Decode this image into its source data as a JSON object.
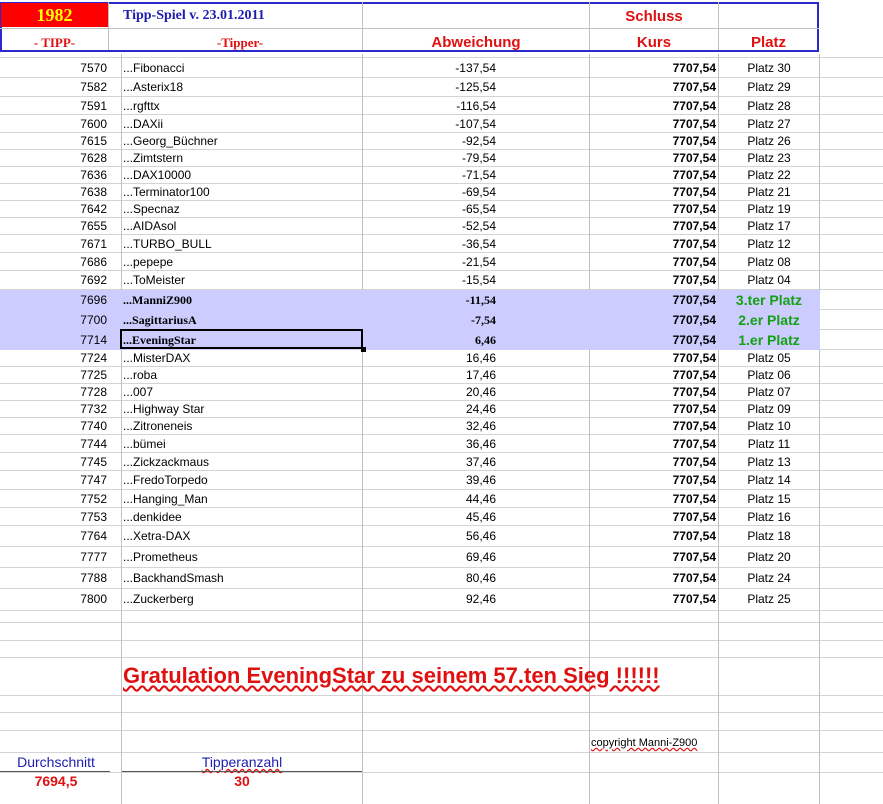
{
  "header": {
    "year": "1982",
    "title": "Tipp-Spiel v. 23.01.2011",
    "schluss": "Schluss",
    "col_tipp": "- TIPP-",
    "col_tipper": "-Tipper-",
    "col_abweichung": "Abweichung",
    "col_kurs": "Kurs",
    "col_platz": "Platz"
  },
  "rows": [
    {
      "tipp": "7570",
      "name": "...Fibonacci",
      "abw": "-137,54",
      "kurs": "7707,54",
      "platz": "Platz 30"
    },
    {
      "tipp": "7582",
      "name": "...Asterix18",
      "abw": "-125,54",
      "kurs": "7707,54",
      "platz": "Platz 29"
    },
    {
      "tipp": "7591",
      "name": "...rgfttx",
      "abw": "-116,54",
      "kurs": "7707,54",
      "platz": "Platz 28"
    },
    {
      "tipp": "7600",
      "name": "...DAXii",
      "abw": "-107,54",
      "kurs": "7707,54",
      "platz": "Platz 27"
    },
    {
      "tipp": "7615",
      "name": "...Georg_Büchner",
      "abw": "-92,54",
      "kurs": "7707,54",
      "platz": "Platz 26"
    },
    {
      "tipp": "7628",
      "name": "...Zimtstern",
      "abw": "-79,54",
      "kurs": "7707,54",
      "platz": "Platz 23"
    },
    {
      "tipp": "7636",
      "name": "...DAX10000",
      "abw": "-71,54",
      "kurs": "7707,54",
      "platz": "Platz 22"
    },
    {
      "tipp": "7638",
      "name": "...Terminator100",
      "abw": "-69,54",
      "kurs": "7707,54",
      "platz": "Platz 21"
    },
    {
      "tipp": "7642",
      "name": "...Specnaz",
      "abw": "-65,54",
      "kurs": "7707,54",
      "platz": "Platz 19"
    },
    {
      "tipp": "7655",
      "name": "...AIDAsol",
      "abw": "-52,54",
      "kurs": "7707,54",
      "platz": "Platz 17"
    },
    {
      "tipp": "7671",
      "name": "...TURBO_BULL",
      "abw": "-36,54",
      "kurs": "7707,54",
      "platz": "Platz 12"
    },
    {
      "tipp": "7686",
      "name": "...pepepe",
      "abw": "-21,54",
      "kurs": "7707,54",
      "platz": "Platz 08"
    },
    {
      "tipp": "7692",
      "name": "...ToMeister",
      "abw": "-15,54",
      "kurs": "7707,54",
      "platz": "Platz 04"
    },
    {
      "tipp": "7696",
      "name": "...ManniZ900",
      "abw": "-11,54",
      "kurs": "7707,54",
      "platz": "3.ter Platz"
    },
    {
      "tipp": "7700",
      "name": "...SagittariusA",
      "abw": "-7,54",
      "kurs": "7707,54",
      "platz": "2.er Platz"
    },
    {
      "tipp": "7714",
      "name": "...EveningStar",
      "abw": "6,46",
      "kurs": "7707,54",
      "platz": "1.er Platz"
    },
    {
      "tipp": "7724",
      "name": "...MisterDAX",
      "abw": "16,46",
      "kurs": "7707,54",
      "platz": "Platz 05"
    },
    {
      "tipp": "7725",
      "name": "...roba",
      "abw": "17,46",
      "kurs": "7707,54",
      "platz": "Platz 06"
    },
    {
      "tipp": "7728",
      "name": "...007",
      "abw": "20,46",
      "kurs": "7707,54",
      "platz": "Platz 07"
    },
    {
      "tipp": "7732",
      "name": "...Highway Star",
      "abw": "24,46",
      "kurs": "7707,54",
      "platz": "Platz 09"
    },
    {
      "tipp": "7740",
      "name": "...Zitroneneis",
      "abw": "32,46",
      "kurs": "7707,54",
      "platz": "Platz 10"
    },
    {
      "tipp": "7744",
      "name": "...bümei",
      "abw": "36,46",
      "kurs": "7707,54",
      "platz": "Platz 11"
    },
    {
      "tipp": "7745",
      "name": "...Zickzackmaus",
      "abw": "37,46",
      "kurs": "7707,54",
      "platz": "Platz 13"
    },
    {
      "tipp": "7747",
      "name": "...FredoTorpedo",
      "abw": "39,46",
      "kurs": "7707,54",
      "platz": "Platz 14"
    },
    {
      "tipp": "7752",
      "name": "...Hanging_Man",
      "abw": "44,46",
      "kurs": "7707,54",
      "platz": "Platz 15"
    },
    {
      "tipp": "7753",
      "name": "...denkidee",
      "abw": "45,46",
      "kurs": "7707,54",
      "platz": "Platz 16"
    },
    {
      "tipp": "7764",
      "name": "...Xetra-DAX",
      "abw": "56,46",
      "kurs": "7707,54",
      "platz": "Platz 18"
    },
    {
      "tipp": "7777",
      "name": "...Prometheus",
      "abw": "69,46",
      "kurs": "7707,54",
      "platz": "Platz 20"
    },
    {
      "tipp": "7788",
      "name": "...BackhandSmash",
      "abw": "80,46",
      "kurs": "7707,54",
      "platz": "Platz 24"
    },
    {
      "tipp": "7800",
      "name": "...Zuckerberg",
      "abw": "92,46",
      "kurs": "7707,54",
      "platz": "Platz 25"
    }
  ],
  "congrats": "Gratulation EveningStar  zu seinem 57.ten Sieg !!!!!!",
  "copyright": "copyright Manni-Z900",
  "footer": {
    "durchschnitt_label": "Durchschnitt",
    "durchschnitt_value": "7694,5",
    "tipperanzahl_label": "Tipperanzahl",
    "tipperanzahl_value": "30"
  },
  "colors": {
    "header_border": "#2a2acb",
    "year_bg": "#ff0000",
    "year_text": "#ffff00",
    "accent_red": "#e01010",
    "highlight_row": "#ccccff",
    "winner_green": "#14a014"
  }
}
